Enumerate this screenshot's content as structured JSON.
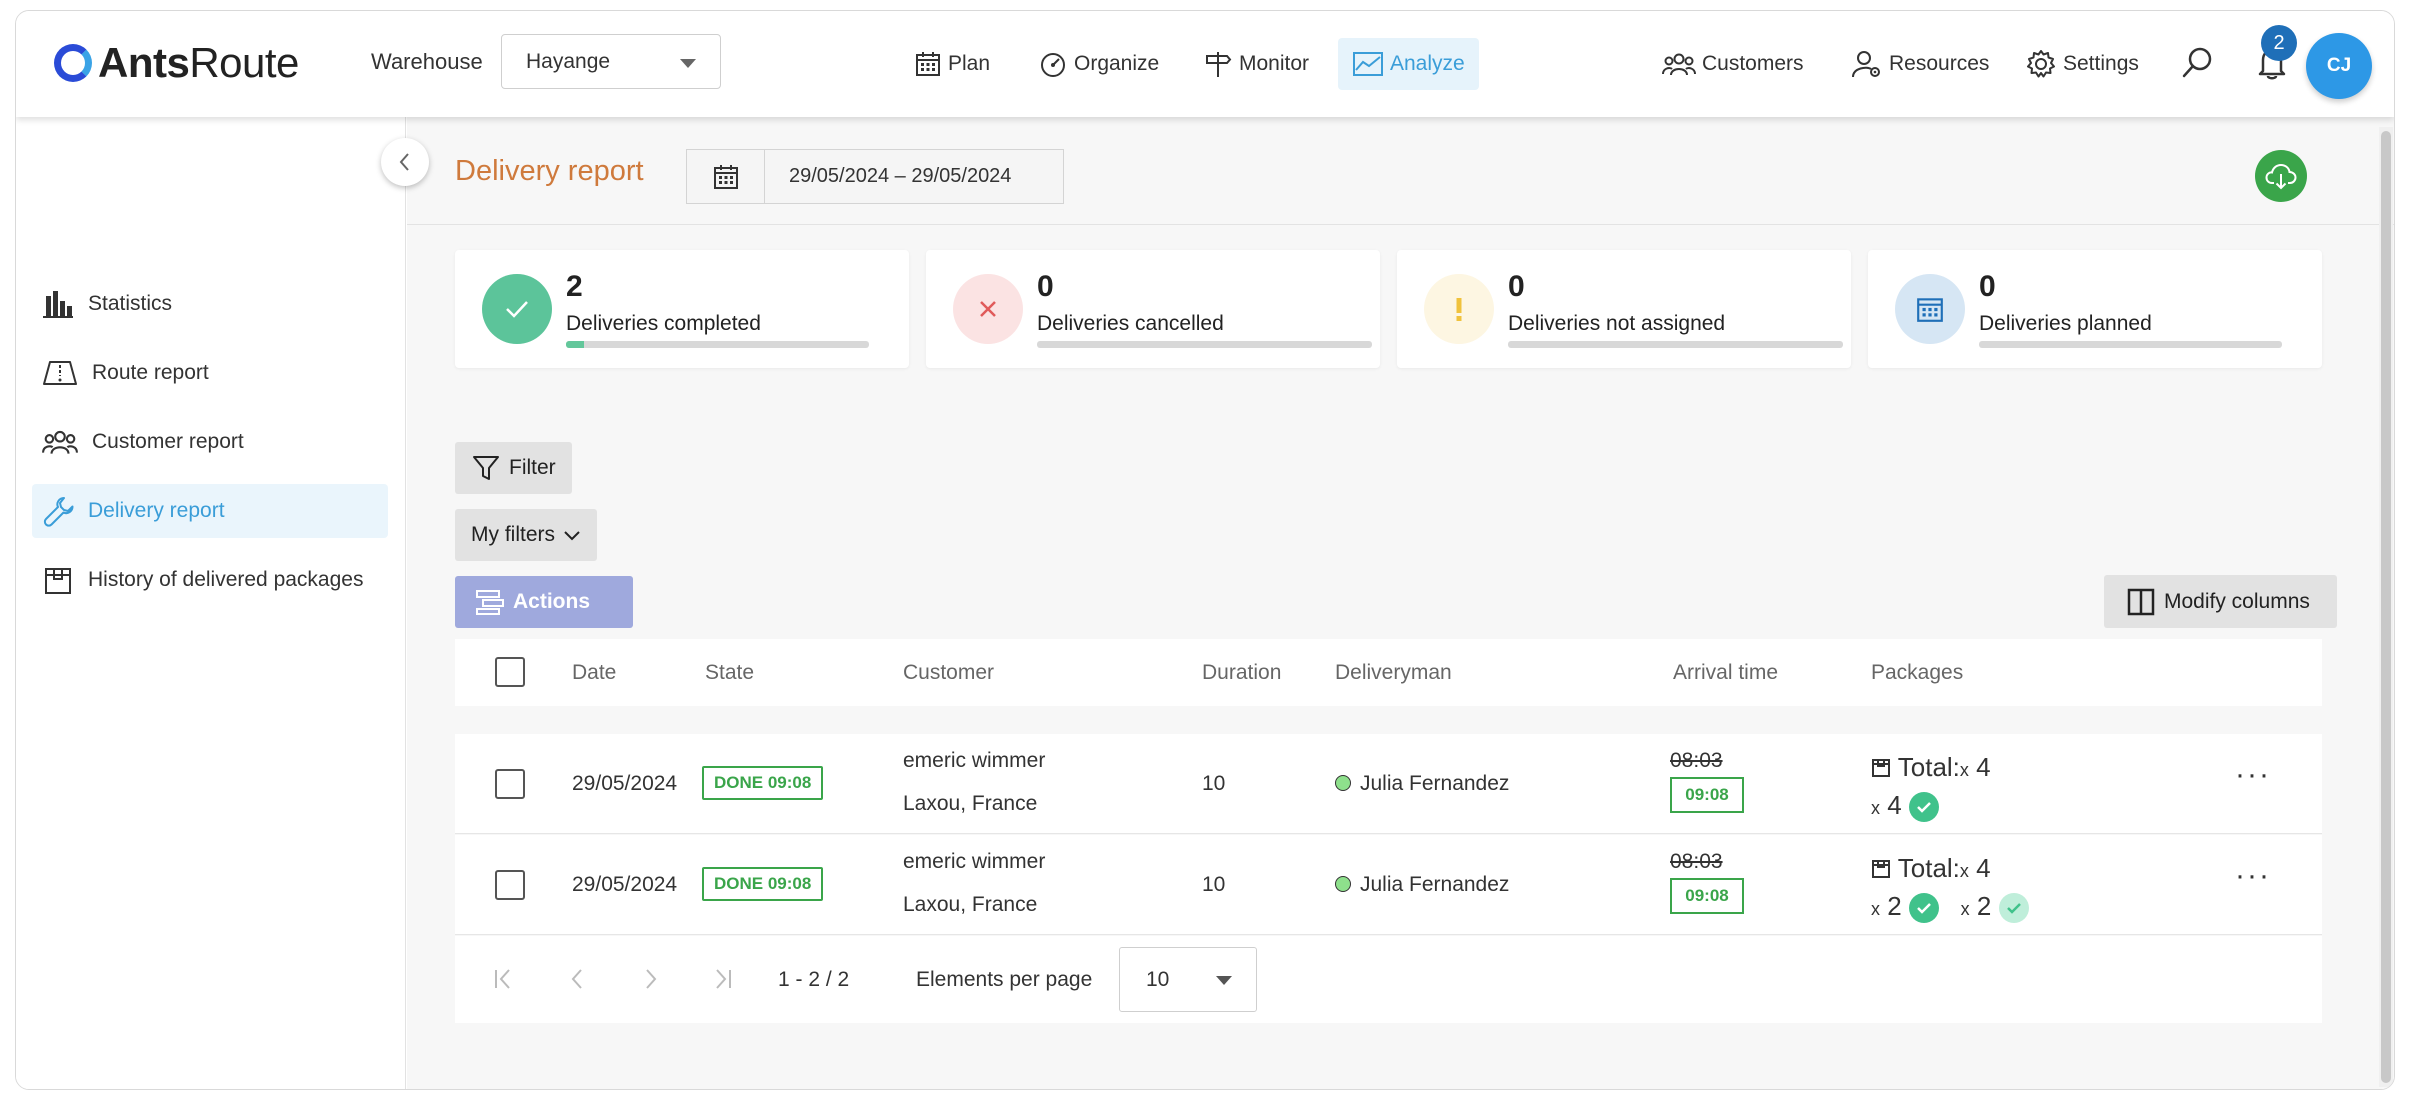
{
  "brand": {
    "name_bold": "Ants",
    "name_rest": "Route"
  },
  "header": {
    "warehouse_label": "Warehouse",
    "warehouse_value": "Hayange",
    "nav": [
      {
        "label": "Plan",
        "icon": "calendar-icon"
      },
      {
        "label": "Organize",
        "icon": "gauge-icon"
      },
      {
        "label": "Monitor",
        "icon": "signpost-icon"
      },
      {
        "label": "Analyze",
        "icon": "area-chart-icon",
        "active": true
      }
    ],
    "right_nav": [
      {
        "label": "Customers",
        "icon": "users-icon"
      },
      {
        "label": "Resources",
        "icon": "user-gear-icon"
      },
      {
        "label": "Settings",
        "icon": "gear-icon"
      }
    ],
    "notifications_count": "2",
    "avatar_initials": "CJ"
  },
  "sidebar": {
    "items": [
      {
        "label": "Statistics",
        "icon": "bar-chart-icon"
      },
      {
        "label": "Route report",
        "icon": "map-icon"
      },
      {
        "label": "Customer report",
        "icon": "users-icon"
      },
      {
        "label": "Delivery report",
        "icon": "wrench-icon",
        "active": true
      },
      {
        "label": "History of delivered packages",
        "icon": "package-icon"
      }
    ]
  },
  "page": {
    "title": "Delivery report",
    "date_range": "29/05/2024 – 29/05/2024"
  },
  "stats": [
    {
      "value": "2",
      "label": "Deliveries completed",
      "color": "#5cc49a",
      "progress": 0.06
    },
    {
      "value": "0",
      "label": "Deliveries cancelled",
      "color": "#fbe3e3",
      "progress": 0
    },
    {
      "value": "0",
      "label": "Deliveries not assigned",
      "color": "#fdf6e2",
      "progress": 0
    },
    {
      "value": "0",
      "label": "Deliveries planned",
      "color": "#d6e6f4",
      "progress": 0
    }
  ],
  "toolbar": {
    "filter_label": "Filter",
    "my_filters_label": "My filters",
    "actions_label": "Actions",
    "modify_columns_label": "Modify columns"
  },
  "table": {
    "columns": [
      "Date",
      "State",
      "Customer",
      "Duration",
      "Deliveryman",
      "Arrival time",
      "Packages"
    ],
    "rows": [
      {
        "date": "29/05/2024",
        "state": "DONE 09:08",
        "customer_name": "emeric wimmer",
        "customer_location": "Laxou, France",
        "duration": "10",
        "deliveryman": "Julia Fernandez",
        "arrival_planned": "08:03",
        "arrival_actual": "09:08",
        "packages_total_label": "Total:",
        "packages_total_x": "x",
        "packages_total": "4",
        "packages_x1": "x",
        "packages_done": "4",
        "packages_x2": "",
        "packages_partial": ""
      },
      {
        "date": "29/05/2024",
        "state": "DONE 09:08",
        "customer_name": "emeric wimmer",
        "customer_location": "Laxou, France",
        "duration": "10",
        "deliveryman": "Julia Fernandez",
        "arrival_planned": "08:03",
        "arrival_actual": "09:08",
        "packages_total_label": "Total:",
        "packages_total_x": "x",
        "packages_total": "4",
        "packages_x1": "x",
        "packages_done": "2",
        "packages_x2": "x",
        "packages_partial": "2"
      }
    ]
  },
  "pagination": {
    "range": "1 - 2 / 2",
    "per_page_label": "Elements per page",
    "per_page_value": "10"
  }
}
